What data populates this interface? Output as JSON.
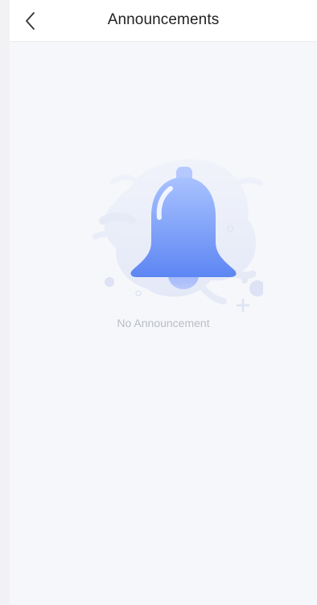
{
  "header": {
    "title": "Announcements",
    "back_icon": "chevron-left-icon"
  },
  "empty_state": {
    "message": "No Announcement",
    "illustration_icon": "bell-icon"
  },
  "colors": {
    "page_background": "#f6f7fa",
    "header_background": "#ffffff",
    "bell_top": "#a9c2ff",
    "bell_bottom": "#5d86f3",
    "splash": "#e8ecf8",
    "muted_text": "#b9bdc6"
  }
}
